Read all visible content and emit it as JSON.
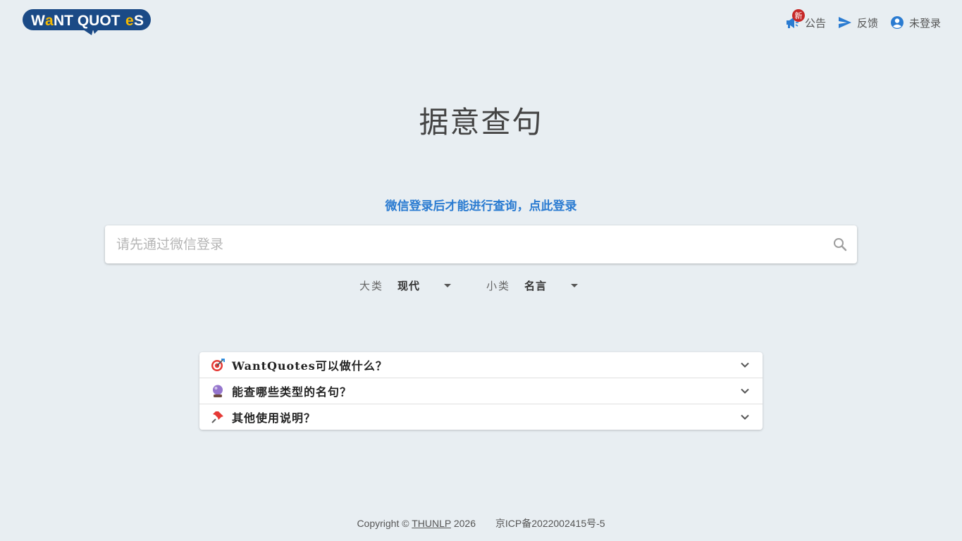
{
  "header": {
    "logo_text": "WANT QUOTES",
    "nav": {
      "announcement_label": "公告",
      "announcement_badge": "新",
      "feedback_label": "反馈",
      "account_label": "未登录"
    }
  },
  "main": {
    "title": "据意查句",
    "login_prompt": "微信登录后才能进行查询，点此登录",
    "search": {
      "placeholder": "请先通过微信登录",
      "value": ""
    },
    "filters": {
      "category": {
        "label": "大类",
        "value": "现代"
      },
      "subcategory": {
        "label": "小类",
        "value": "名言"
      }
    },
    "faq": [
      {
        "icon": "target-icon",
        "title": "WantQuotes可以做什么？"
      },
      {
        "icon": "crystal-ball-icon",
        "title": "能查哪些类型的名句？"
      },
      {
        "icon": "pushpin-icon",
        "title": "其他使用说明？"
      }
    ]
  },
  "footer": {
    "copyright_prefix": "Copyright ©",
    "org_link": "THUNLP",
    "year": "2026",
    "icp": "京ICP备2022002415号-5"
  },
  "colors": {
    "background": "#e8eef2",
    "accent_blue": "#2a7bd1",
    "logo_navy": "#1b4a86",
    "logo_gold": "#f5b800",
    "badge_red": "#c62828"
  }
}
